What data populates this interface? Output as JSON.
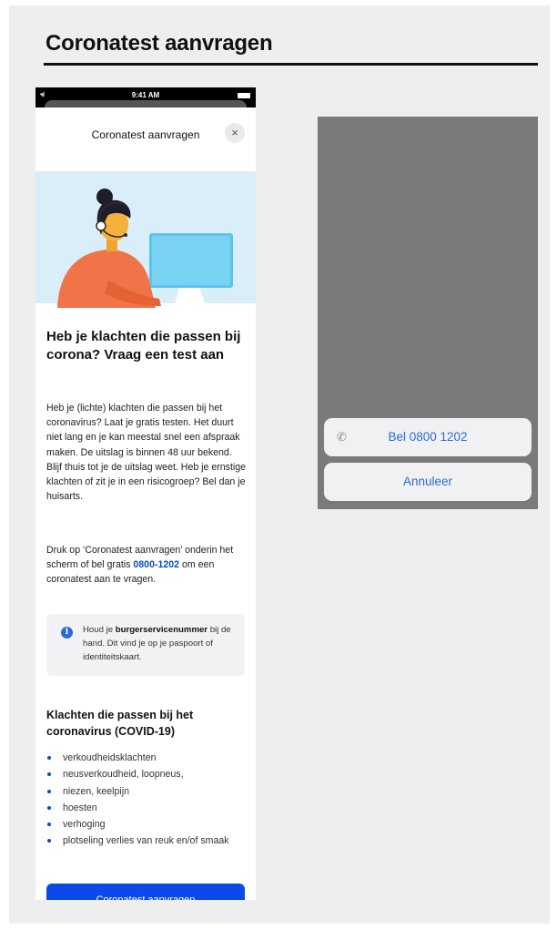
{
  "page": {
    "title": "Coronatest aanvragen"
  },
  "phone": {
    "status": {
      "time": "9:41 AM",
      "signal": "•ııl"
    },
    "nav": {
      "title": "Coronatest aanvragen",
      "close_icon": "×"
    },
    "heading": "Heb je klachten die passen bij corona? Vraag een test aan",
    "body": "Heb je (lichte) klachten die passen bij het coronavirus? Laat je gratis testen. Het duurt niet lang en je kan meestal snel een afspraak maken. De uitslag is binnen 48 uur bekend. Blijf thuis tot je de uitslag weet. Heb je ernstige klachten of zit je in een risicogroep? Bel dan je huisarts.",
    "instruction": {
      "before": "Druk op ‘Coronatest aanvragen’ onderin het scherm of bel gratis ",
      "phone_link": "0800-1202",
      "after": " om een coronatest aan te vragen."
    },
    "info": {
      "icon": "i",
      "prefix": "Houd je ",
      "bold": "burgerservicenummer",
      "suffix": " bij de hand. Dit vind je op je paspoort of identiteitskaart."
    },
    "symptoms_title": "Klachten die passen bij het coronavirus (COVID-19)",
    "symptoms": [
      "verkoudheidsklachten",
      "neusverkoudheid, loopneus,",
      "niezen, keelpijn",
      "hoesten",
      "verhoging",
      "plotseling verlies van reuk en/of smaak"
    ],
    "primary_button": "Coronatest aanvragen"
  },
  "action_sheet": {
    "call_label": "Bel 0800 1202",
    "call_icon": "✆",
    "cancel_label": "Annuleer"
  },
  "colors": {
    "accent": "#0b49e8",
    "link": "#2a6ad8",
    "illustration_bg": "#d9eef8",
    "panel_overlay": "#7a7a7a"
  }
}
